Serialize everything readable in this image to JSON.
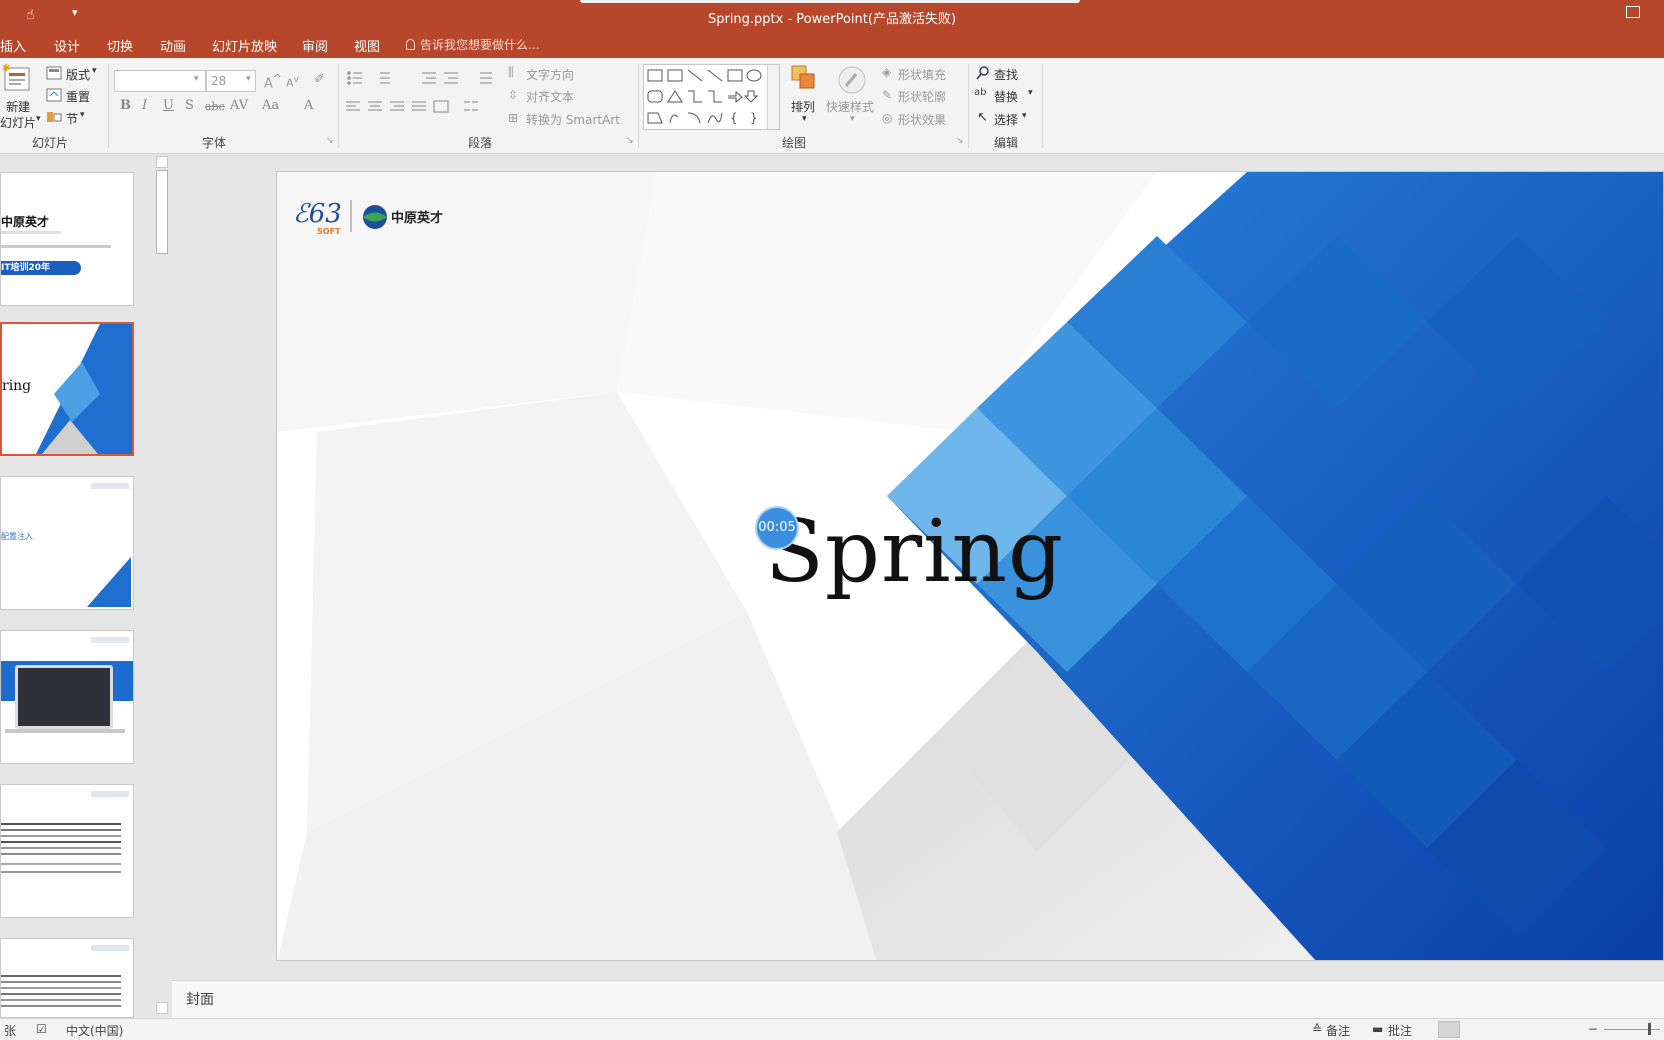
{
  "window": {
    "title": "Spring.pptx - PowerPoint(产品激活失败)"
  },
  "tabs": [
    "插入",
    "设计",
    "切换",
    "动画",
    "幻灯片放映",
    "审阅",
    "视图"
  ],
  "tellme": "告诉我您想要做什么...",
  "ribbon": {
    "slides_group": {
      "label": "幻灯片",
      "new_slide": "新建",
      "new_slide_2": "幻灯片",
      "layout": "版式",
      "reset": "重置",
      "section": "节"
    },
    "font_group": {
      "label": "字体",
      "font_name": "",
      "font_size": "28"
    },
    "paragraph_group": {
      "label": "段落",
      "text_direction": "文字方向",
      "align_text": "对齐文本",
      "convert_smartart": "转换为 SmartArt"
    },
    "drawing_group": {
      "label": "绘图",
      "arrange": "排列",
      "quick_styles": "快速样式",
      "shape_fill": "形状填充",
      "shape_outline": "形状轮廓",
      "shape_effects": "形状效果"
    },
    "editing_group": {
      "label": "编辑",
      "find": "查找",
      "replace": "替换",
      "select": "选择"
    }
  },
  "thumbnails": [
    {
      "title": "中原英才",
      "line1": "IT培训20年"
    },
    {
      "title": "ring"
    },
    {
      "text": "配置注入"
    },
    {},
    {},
    {}
  ],
  "slide": {
    "title": "Spring",
    "logo_text": "中原英才",
    "logo_soft": "SOFT",
    "timer": "00:05"
  },
  "notes": {
    "label": "封面"
  },
  "status": {
    "slide_counter": "张",
    "language": "中文(中国)",
    "notes_btn": "备注",
    "comments_btn": "批注"
  },
  "colors": {
    "accent": "#b7472a",
    "slide_blue": "#1f6fd1"
  }
}
